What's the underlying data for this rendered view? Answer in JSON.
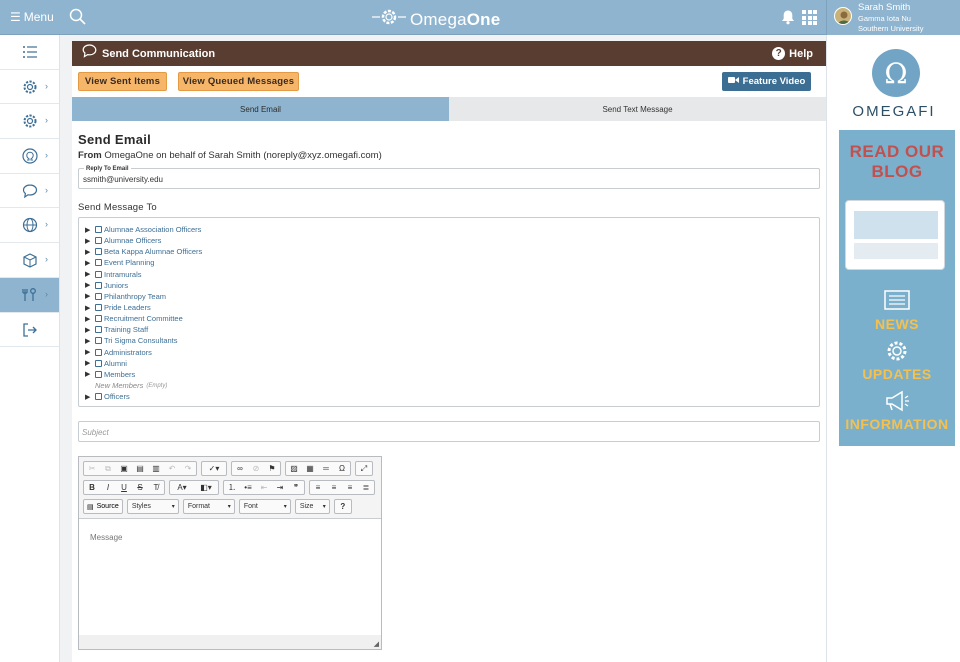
{
  "topbar": {
    "menu_label": "Menu",
    "brand_prefix": "Omega",
    "brand_suffix": "One"
  },
  "user": {
    "name": "Sarah Smith",
    "chapter": "Gamma Iota Nu",
    "school": "Southern University"
  },
  "panel": {
    "title": "Send Communication",
    "help_label": "Help"
  },
  "actions": {
    "sent_label": "View Sent Items",
    "queued_label": "View Queued Messages",
    "video_label": "Feature Video"
  },
  "tabs": [
    {
      "label": "Send Email"
    },
    {
      "label": "Send Text Message"
    }
  ],
  "form": {
    "heading": "Send Email",
    "from_label": "From",
    "from_value": "OmegaOne on behalf of Sarah Smith (noreply@xyz.omegafi.com)",
    "reply_label": "Reply To Email",
    "reply_value": "ssmith@university.edu",
    "send_to_label": "Send Message To",
    "subject_placeholder": "Subject",
    "message_placeholder": "Message"
  },
  "recipients": [
    {
      "label": "Alumnae Association Officers"
    },
    {
      "label": "Alumnae Officers"
    },
    {
      "label": "Beta Kappa Alumnae Officers"
    },
    {
      "label": "Event Planning"
    },
    {
      "label": "Intramurals"
    },
    {
      "label": "Juniors"
    },
    {
      "label": "Philanthropy Team"
    },
    {
      "label": "Pride Leaders"
    },
    {
      "label": "Recruitment Committee"
    },
    {
      "label": "Training Staff"
    },
    {
      "label": "Tri Sigma Consultants"
    },
    {
      "label": "Administrators"
    },
    {
      "label": "Alumni"
    },
    {
      "label": "Members"
    }
  ],
  "empty_group": {
    "label": "New Members",
    "tag": "(Empty)"
  },
  "last_group": {
    "label": "Officers"
  },
  "editor": {
    "source_label": "Source",
    "styles_label": "Styles",
    "format_label": "Format",
    "font_label": "Font",
    "size_label": "Size"
  },
  "ad": {
    "brand": "OMEGAFI",
    "headline_1": "READ OUR",
    "headline_2": "BLOG",
    "word_1": "NEWS",
    "word_2": "UPDATES",
    "word_3": "INFORMATION"
  },
  "colors": {
    "topbar": "#8fb4cf",
    "panel_header": "#5a3d31",
    "orange_button": "#f6b669",
    "video_button": "#3c6d93",
    "link": "#3d6f96",
    "ad_bg": "#7ab0cc",
    "ad_red": "#c2504e",
    "ad_yellow": "#f4c150"
  }
}
